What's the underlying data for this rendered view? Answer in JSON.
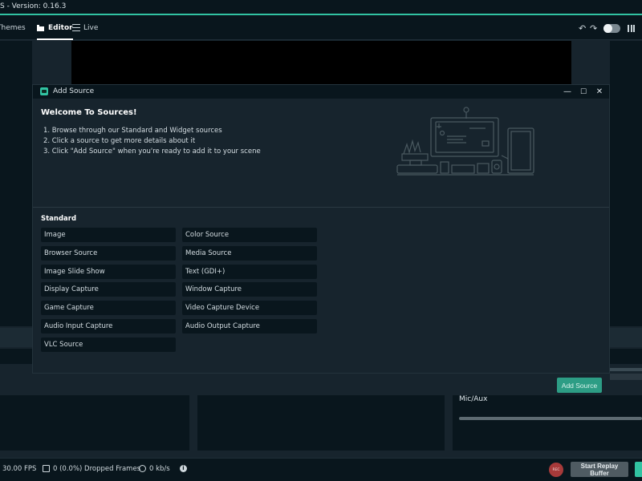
{
  "app": {
    "title": "S - Version: 0.16.3"
  },
  "nav": {
    "themes_label": "Themes",
    "editor_label": "Editor",
    "live_label": "Live",
    "undo_glyph": "↶",
    "redo_glyph": "↷"
  },
  "modal": {
    "title": "Add Source",
    "minimize_glyph": "—",
    "maximize_glyph": "☐",
    "close_glyph": "✕",
    "welcome_title": "Welcome To Sources!",
    "steps": [
      "1. Browse through our Standard and Widget sources",
      "2. Click a source to get more details about it",
      "3. Click \"Add Source\" when you're ready to add it to your scene"
    ],
    "standard_heading": "Standard",
    "standard_left": [
      "Image",
      "Browser Source",
      "Image Slide Show",
      "Display Capture",
      "Game Capture",
      "Audio Input Capture",
      "VLC Source"
    ],
    "standard_right": [
      "Color Source",
      "Media Source",
      "Text (GDI+)",
      "Window Capture",
      "Video Capture Device",
      "Audio Output Capture"
    ]
  },
  "editor": {
    "add_source_label": "Add Source",
    "mixer_label": "Mic/Aux",
    "mixer_level": 1.0
  },
  "footer": {
    "fps": "30.00 FPS",
    "dropped_frames": "0 (0.0%) Dropped Frames",
    "bitrate": "0 kb/s",
    "info_glyph": "i",
    "rec_label": "REC",
    "replay_label": "Start Replay Buffer"
  },
  "colors": {
    "accent": "#31c3a2",
    "background": "#17242d",
    "panel": "#09161d",
    "record": "#a73a3a"
  }
}
